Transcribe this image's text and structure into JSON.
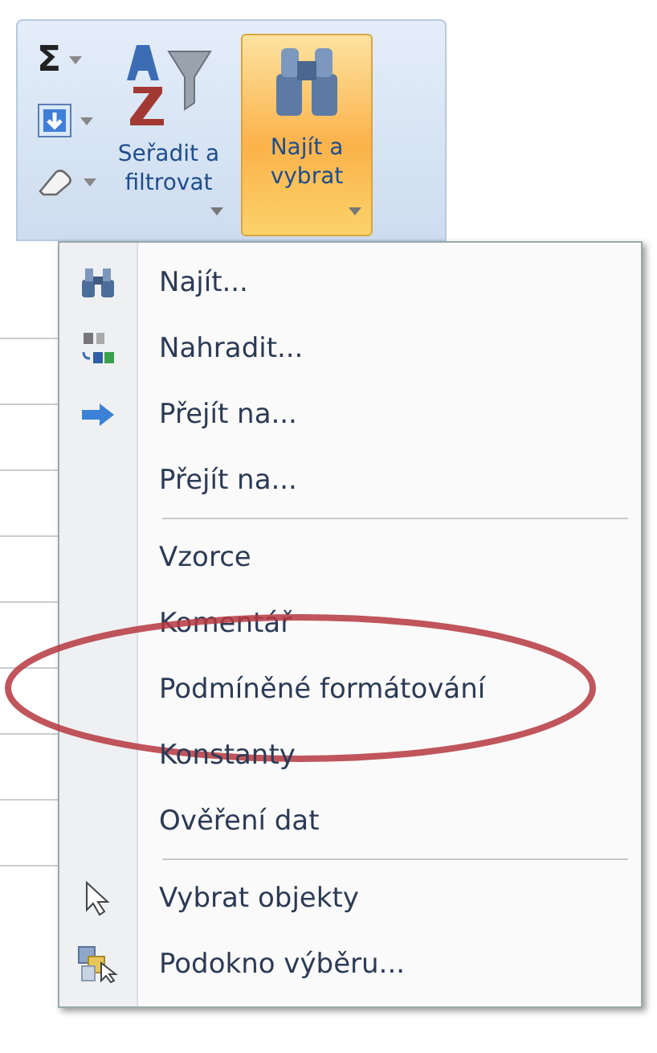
{
  "ribbon": {
    "small_buttons": [
      {
        "kind": "sum",
        "label": "Σ"
      },
      {
        "kind": "fill"
      },
      {
        "kind": "clear"
      }
    ],
    "big_buttons": [
      {
        "kind": "sort",
        "label": "Seřadit a filtrovat",
        "selected": false
      },
      {
        "kind": "find",
        "label": "Najít a vybrat",
        "selected": true
      }
    ]
  },
  "menu": {
    "groups": [
      [
        {
          "kind": "find",
          "label": "Najít...",
          "circled": false
        },
        {
          "kind": "replace",
          "label": "Nahradit...",
          "circled": false
        },
        {
          "kind": "goto",
          "label": "Přejít na...",
          "circled": false
        },
        {
          "kind": "none",
          "label": "Přejít na...",
          "circled": false
        }
      ],
      [
        {
          "kind": "none",
          "label": "Vzorce",
          "circled": false
        },
        {
          "kind": "none",
          "label": "Komentář",
          "circled": false
        },
        {
          "kind": "none",
          "label": "Podmíněné formátování",
          "circled": true
        },
        {
          "kind": "none",
          "label": "Konstanty",
          "circled": false
        },
        {
          "kind": "none",
          "label": "Ověření dat",
          "circled": false
        }
      ],
      [
        {
          "kind": "pointer",
          "label": "Vybrat objekty",
          "circled": false
        },
        {
          "kind": "pane",
          "label": "Podokno výběru...",
          "circled": false
        }
      ]
    ]
  }
}
